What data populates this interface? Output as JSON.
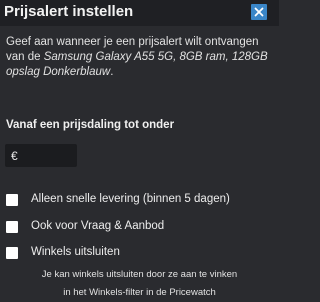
{
  "dialog": {
    "title": "Prijsalert instellen",
    "close_icon": "close-icon"
  },
  "intro": {
    "text_before": "Geef aan wanneer je een prijsalert wilt ontvangen van de ",
    "product": "Samsung Galaxy A55 5G, 8GB ram, 128GB opslag Donkerblauw",
    "text_after": "."
  },
  "price_section": {
    "label": "Vanaf een prijsdaling tot onder",
    "currency": "€",
    "value": "",
    "placeholder": ""
  },
  "options": [
    {
      "label": "Alleen snelle levering (binnen 5 dagen)",
      "checked": false
    },
    {
      "label": "Ook voor Vraag & Aanbod",
      "checked": false
    },
    {
      "label": "Winkels uitsluiten",
      "checked": false
    }
  ],
  "note": {
    "line1": "Je kan winkels uitsluiten door ze aan te vinken",
    "line2": "in het Winkels-filter in de Pricewatch"
  },
  "colors": {
    "background": "#2a2b2f",
    "header": "#1f2024",
    "close_button": "#3a86c8",
    "input_background": "#1b1c1f"
  }
}
